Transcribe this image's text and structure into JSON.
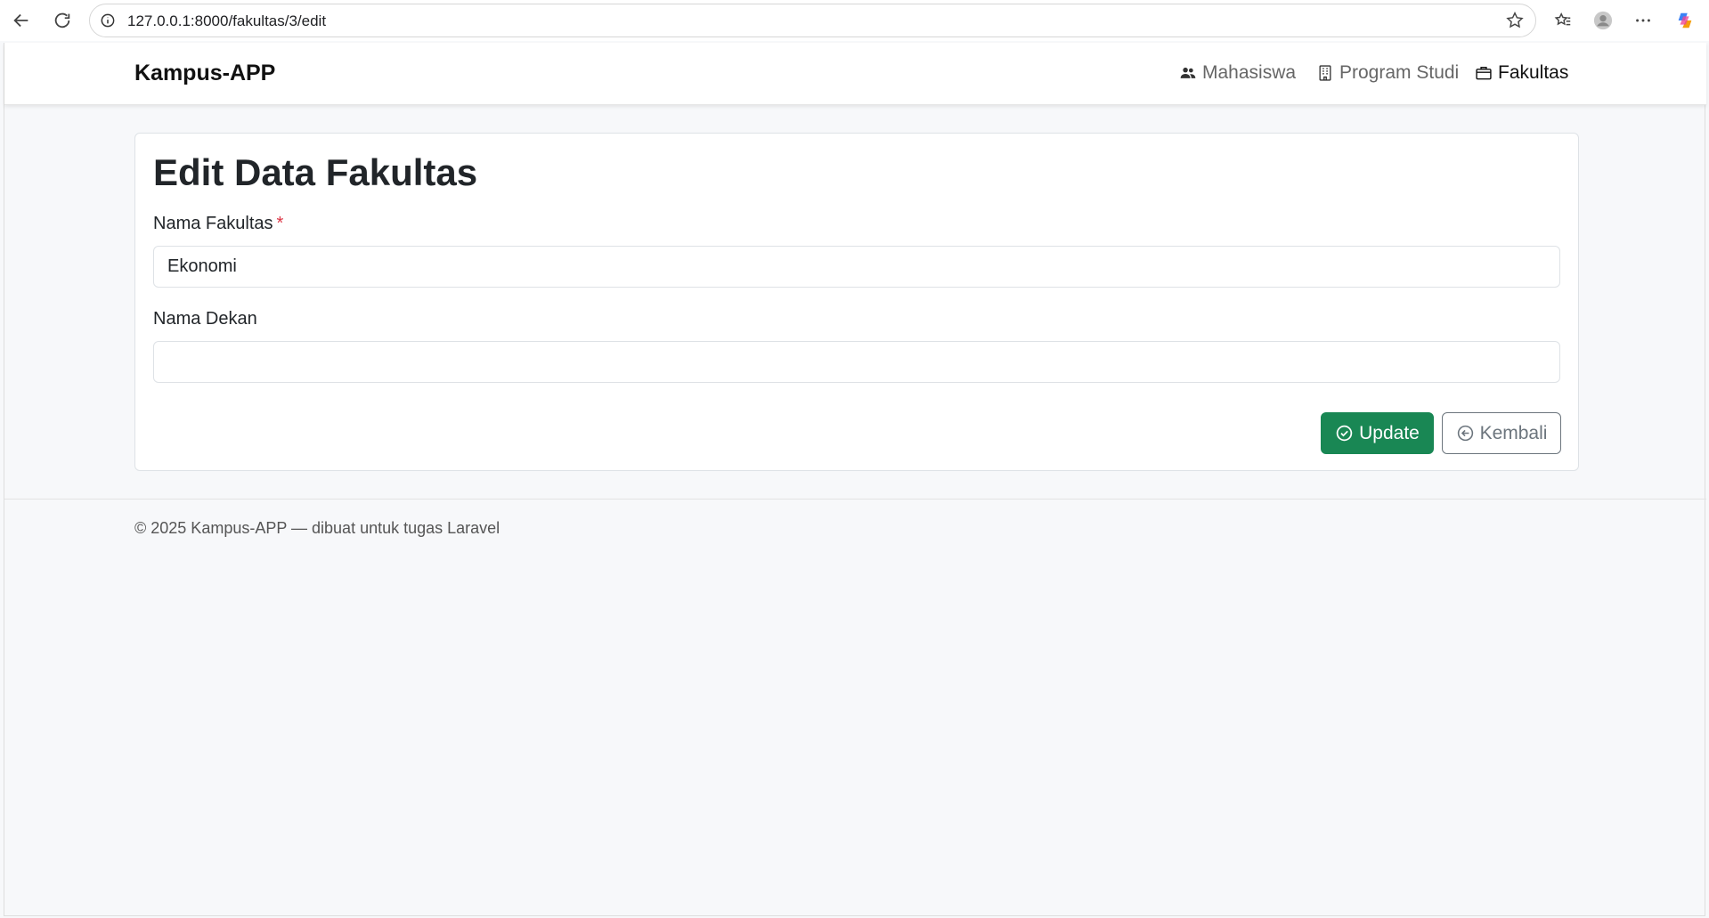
{
  "browser": {
    "url": "127.0.0.1:8000/fakultas/3/edit"
  },
  "navbar": {
    "brand": "Kampus-APP",
    "items": [
      {
        "label": "Mahasiswa",
        "icon": "people-icon",
        "active": false
      },
      {
        "label": "Program Studi",
        "icon": "building-icon",
        "active": false
      },
      {
        "label": "Fakultas",
        "icon": "briefcase-icon",
        "active": true
      }
    ]
  },
  "form": {
    "title": "Edit Data Fakultas",
    "fields": [
      {
        "label": "Nama Fakultas",
        "required_mark": "*",
        "value": "Ekonomi"
      },
      {
        "label": "Nama Dekan",
        "value": ""
      }
    ],
    "update_label": "Update",
    "back_label": "Kembali"
  },
  "footer": {
    "text": "© 2025 Kampus-APP — dibuat untuk tugas Laravel"
  },
  "colors": {
    "primary_success": "#198754",
    "secondary": "#6c757d",
    "required": "#dc3545"
  }
}
